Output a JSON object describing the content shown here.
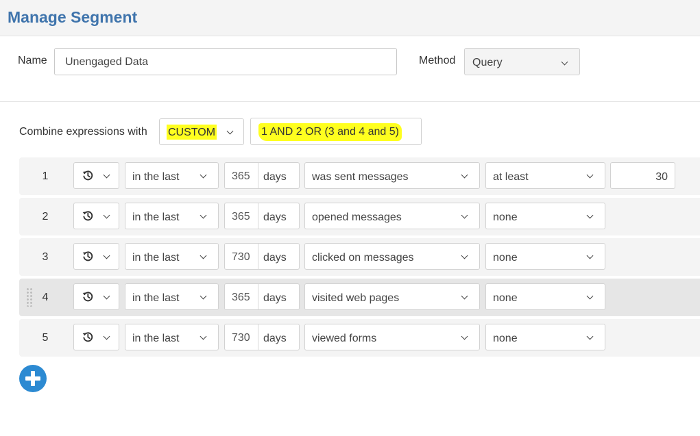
{
  "header": {
    "title": "Manage Segment"
  },
  "form": {
    "name_label": "Name",
    "name_value": "Unengaged Data",
    "method_label": "Method",
    "method_value": "Query"
  },
  "combine": {
    "label": "Combine expressions with",
    "mode": "CUSTOM",
    "expression": "1 AND 2 OR (3 and 4 and 5)",
    "highlight_color": "#ffff1f"
  },
  "rows": [
    {
      "num": "1",
      "range": "in the last",
      "amount": "365",
      "unit": "days",
      "action": "was sent messages",
      "comparison": "at least",
      "count": "30"
    },
    {
      "num": "2",
      "range": "in the last",
      "amount": "365",
      "unit": "days",
      "action": "opened messages",
      "comparison": "none"
    },
    {
      "num": "3",
      "range": "in the last",
      "amount": "730",
      "unit": "days",
      "action": "clicked on messages",
      "comparison": "none"
    },
    {
      "num": "4",
      "range": "in the last",
      "amount": "365",
      "unit": "days",
      "action": "visited web pages",
      "comparison": "none"
    },
    {
      "num": "5",
      "range": "in the last",
      "amount": "730",
      "unit": "days",
      "action": "viewed forms",
      "comparison": "none"
    }
  ],
  "icons": {
    "history": "history-icon",
    "add": "plus-circle-icon",
    "chevron": "chevron-down-icon",
    "drag": "drag-handle-icon"
  },
  "colors": {
    "title": "#3f74ac",
    "add_button": "#2c8ad2"
  }
}
